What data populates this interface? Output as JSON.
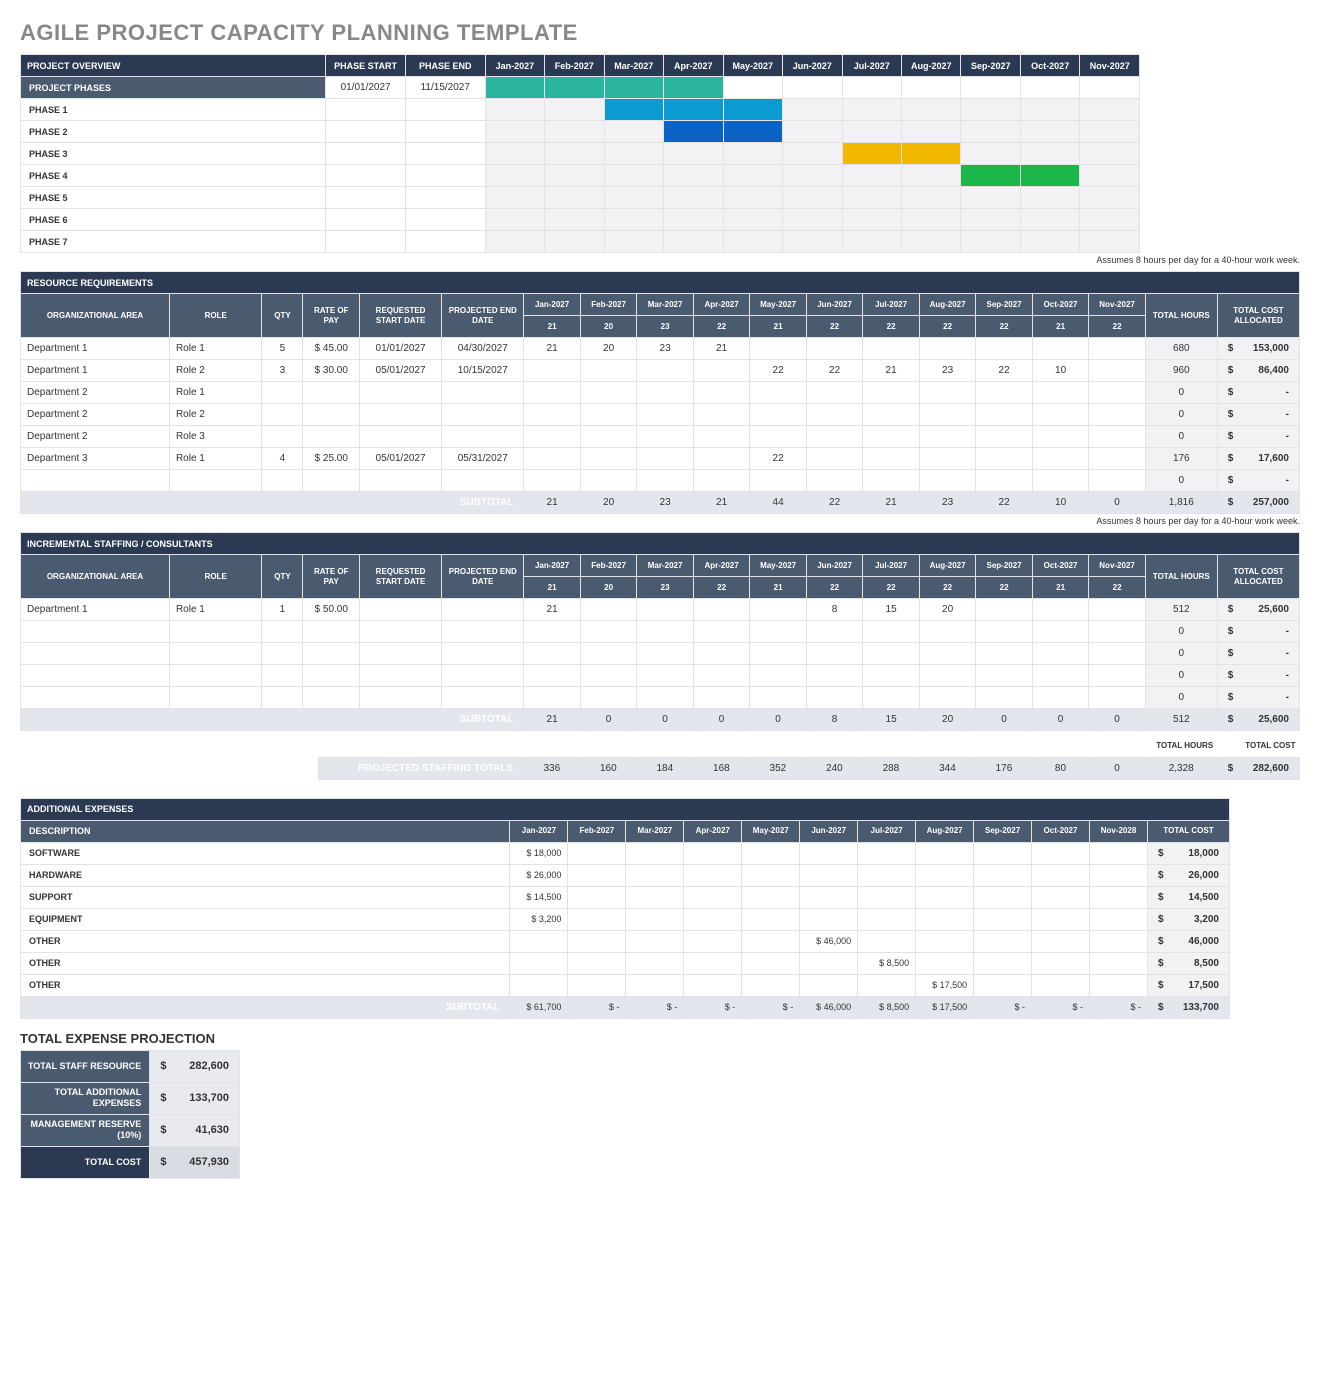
{
  "title": "AGILE PROJECT CAPACITY PLANNING TEMPLATE",
  "note": "Assumes 8 hours per day for a 40-hour work week.",
  "months": [
    "Jan-2027",
    "Feb-2027",
    "Mar-2027",
    "Apr-2027",
    "May-2027",
    "Jun-2027",
    "Jul-2027",
    "Aug-2027",
    "Sep-2027",
    "Oct-2027",
    "Nov-2027"
  ],
  "overview": {
    "header": "PROJECT OVERVIEW",
    "cols": {
      "phase_start": "PHASE START",
      "phase_end": "PHASE END"
    },
    "phases_row": {
      "label": "PROJECT PHASES",
      "start": "01/01/2027",
      "end": "11/15/2027"
    },
    "rows": [
      {
        "label": "PHASE 1"
      },
      {
        "label": "PHASE 2"
      },
      {
        "label": "PHASE 3"
      },
      {
        "label": "PHASE 4"
      },
      {
        "label": "PHASE 5"
      },
      {
        "label": "PHASE 6"
      },
      {
        "label": "PHASE 7"
      }
    ]
  },
  "resource": {
    "header": "RESOURCE REQUIREMENTS",
    "cols": {
      "org": "ORGANIZATIONAL AREA",
      "role": "ROLE",
      "qty": "QTY",
      "rate": "RATE OF PAY",
      "req": "REQUESTED START DATE",
      "end": "PROJECTED END DATE",
      "hours": "TOTAL HOURS",
      "cost": "TOTAL COST ALLOCATED"
    },
    "month_sub": [
      "21",
      "20",
      "23",
      "22",
      "21",
      "22",
      "22",
      "22",
      "22",
      "21",
      "22"
    ],
    "rows": [
      {
        "org": "Department 1",
        "role": "Role 1",
        "qty": "5",
        "rate": "$ 45.00",
        "req": "01/01/2027",
        "end": "04/30/2027",
        "m": [
          "21",
          "20",
          "23",
          "21",
          "",
          "",
          "",
          "",
          "",
          "",
          ""
        ],
        "hours": "680",
        "cost": "153,000"
      },
      {
        "org": "Department 1",
        "role": "Role 2",
        "qty": "3",
        "rate": "$ 30.00",
        "req": "05/01/2027",
        "end": "10/15/2027",
        "m": [
          "",
          "",
          "",
          "",
          "22",
          "22",
          "21",
          "23",
          "22",
          "10",
          ""
        ],
        "hours": "960",
        "cost": "86,400"
      },
      {
        "org": "Department 2",
        "role": "Role 1",
        "qty": "",
        "rate": "",
        "req": "",
        "end": "",
        "m": [
          "",
          "",
          "",
          "",
          "",
          "",
          "",
          "",
          "",
          "",
          ""
        ],
        "hours": "0",
        "cost": "-"
      },
      {
        "org": "Department 2",
        "role": "Role 2",
        "qty": "",
        "rate": "",
        "req": "",
        "end": "",
        "m": [
          "",
          "",
          "",
          "",
          "",
          "",
          "",
          "",
          "",
          "",
          ""
        ],
        "hours": "0",
        "cost": "-"
      },
      {
        "org": "Department 2",
        "role": "Role 3",
        "qty": "",
        "rate": "",
        "req": "",
        "end": "",
        "m": [
          "",
          "",
          "",
          "",
          "",
          "",
          "",
          "",
          "",
          "",
          ""
        ],
        "hours": "0",
        "cost": "-"
      },
      {
        "org": "Department 3",
        "role": "Role 1",
        "qty": "4",
        "rate": "$ 25.00",
        "req": "05/01/2027",
        "end": "05/31/2027",
        "m": [
          "",
          "",
          "",
          "",
          "22",
          "",
          "",
          "",
          "",
          "",
          ""
        ],
        "hours": "176",
        "cost": "17,600"
      },
      {
        "org": "",
        "role": "",
        "qty": "",
        "rate": "",
        "req": "",
        "end": "",
        "m": [
          "",
          "",
          "",
          "",
          "",
          "",
          "",
          "",
          "",
          "",
          ""
        ],
        "hours": "0",
        "cost": "-"
      }
    ],
    "subtotal_label": "SUBTOTAL",
    "subtotal": {
      "m": [
        "21",
        "20",
        "23",
        "21",
        "44",
        "22",
        "21",
        "23",
        "22",
        "10",
        "0"
      ],
      "hours": "1,816",
      "cost": "257,000"
    }
  },
  "consultants": {
    "header": "INCREMENTAL STAFFING / CONSULTANTS",
    "month_sub": [
      "21",
      "20",
      "23",
      "22",
      "21",
      "22",
      "22",
      "22",
      "22",
      "21",
      "22"
    ],
    "rows": [
      {
        "org": "Department 1",
        "role": "Role 1",
        "qty": "1",
        "rate": "$ 50.00",
        "req": "",
        "end": "",
        "m": [
          "21",
          "",
          "",
          "",
          "",
          "8",
          "15",
          "20",
          "",
          "",
          ""
        ],
        "hours": "512",
        "cost": "25,600"
      },
      {
        "org": "",
        "role": "",
        "qty": "",
        "rate": "",
        "req": "",
        "end": "",
        "m": [
          "",
          "",
          "",
          "",
          "",
          "",
          "",
          "",
          "",
          "",
          ""
        ],
        "hours": "0",
        "cost": "-"
      },
      {
        "org": "",
        "role": "",
        "qty": "",
        "rate": "",
        "req": "",
        "end": "",
        "m": [
          "",
          "",
          "",
          "",
          "",
          "",
          "",
          "",
          "",
          "",
          ""
        ],
        "hours": "0",
        "cost": "-"
      },
      {
        "org": "",
        "role": "",
        "qty": "",
        "rate": "",
        "req": "",
        "end": "",
        "m": [
          "",
          "",
          "",
          "",
          "",
          "",
          "",
          "",
          "",
          "",
          ""
        ],
        "hours": "0",
        "cost": "-"
      },
      {
        "org": "",
        "role": "",
        "qty": "",
        "rate": "",
        "req": "",
        "end": "",
        "m": [
          "",
          "",
          "",
          "",
          "",
          "",
          "",
          "",
          "",
          "",
          ""
        ],
        "hours": "0",
        "cost": "-"
      }
    ],
    "subtotal_label": "SUBTOTAL",
    "subtotal": {
      "m": [
        "21",
        "0",
        "0",
        "0",
        "0",
        "8",
        "15",
        "20",
        "0",
        "0",
        "0"
      ],
      "hours": "512",
      "cost": "25,600"
    },
    "totals_hdr": {
      "hours": "TOTAL HOURS",
      "cost": "TOTAL COST"
    },
    "projected_label": "PROJECTED STAFFING TOTALS",
    "projected": {
      "m": [
        "336",
        "160",
        "184",
        "168",
        "352",
        "240",
        "288",
        "344",
        "176",
        "80",
        "0"
      ],
      "hours": "2,328",
      "cost": "282,600"
    }
  },
  "expenses": {
    "header": "ADDITIONAL EXPENSES",
    "cols": {
      "desc": "DESCRIPTION",
      "total": "TOTAL COST"
    },
    "months": [
      "Jan-2027",
      "Feb-2027",
      "Mar-2027",
      "Apr-2027",
      "May-2027",
      "Jun-2027",
      "Jul-2027",
      "Aug-2027",
      "Sep-2027",
      "Oct-2027",
      "Nov-2028"
    ],
    "rows": [
      {
        "desc": "SOFTWARE",
        "m": [
          "$ 18,000",
          "",
          "",
          "",
          "",
          "",
          "",
          "",
          "",
          "",
          ""
        ],
        "total": "18,000"
      },
      {
        "desc": "HARDWARE",
        "m": [
          "$ 26,000",
          "",
          "",
          "",
          "",
          "",
          "",
          "",
          "",
          "",
          ""
        ],
        "total": "26,000"
      },
      {
        "desc": "SUPPORT",
        "m": [
          "$ 14,500",
          "",
          "",
          "",
          "",
          "",
          "",
          "",
          "",
          "",
          ""
        ],
        "total": "14,500"
      },
      {
        "desc": "EQUIPMENT",
        "m": [
          "$   3,200",
          "",
          "",
          "",
          "",
          "",
          "",
          "",
          "",
          "",
          ""
        ],
        "total": "3,200"
      },
      {
        "desc": "OTHER",
        "m": [
          "",
          "",
          "",
          "",
          "",
          "$ 46,000",
          "",
          "",
          "",
          "",
          ""
        ],
        "total": "46,000"
      },
      {
        "desc": "OTHER",
        "m": [
          "",
          "",
          "",
          "",
          "",
          "",
          "$  8,500",
          "",
          "",
          "",
          ""
        ],
        "total": "8,500"
      },
      {
        "desc": "OTHER",
        "m": [
          "",
          "",
          "",
          "",
          "",
          "",
          "",
          "$ 17,500",
          "",
          "",
          ""
        ],
        "total": "17,500"
      }
    ],
    "subtotal_label": "SUBTOTAL",
    "subtotal": {
      "m": [
        "$ 61,700",
        "$      -",
        "$      -",
        "$      -",
        "$      -",
        "$ 46,000",
        "$  8,500",
        "$ 17,500",
        "$      -",
        "$      -",
        "$      -"
      ],
      "total": "133,700"
    }
  },
  "projection": {
    "header": "TOTAL EXPENSE PROJECTION",
    "rows": [
      {
        "label": "TOTAL STAFF RESOURCE",
        "val": "282,600"
      },
      {
        "label": "TOTAL ADDITIONAL EXPENSES",
        "val": "133,700"
      },
      {
        "label": "MANAGEMENT RESERVE (10%)",
        "val": "41,630"
      },
      {
        "label": "TOTAL COST",
        "val": "457,930",
        "bold": true
      }
    ]
  }
}
